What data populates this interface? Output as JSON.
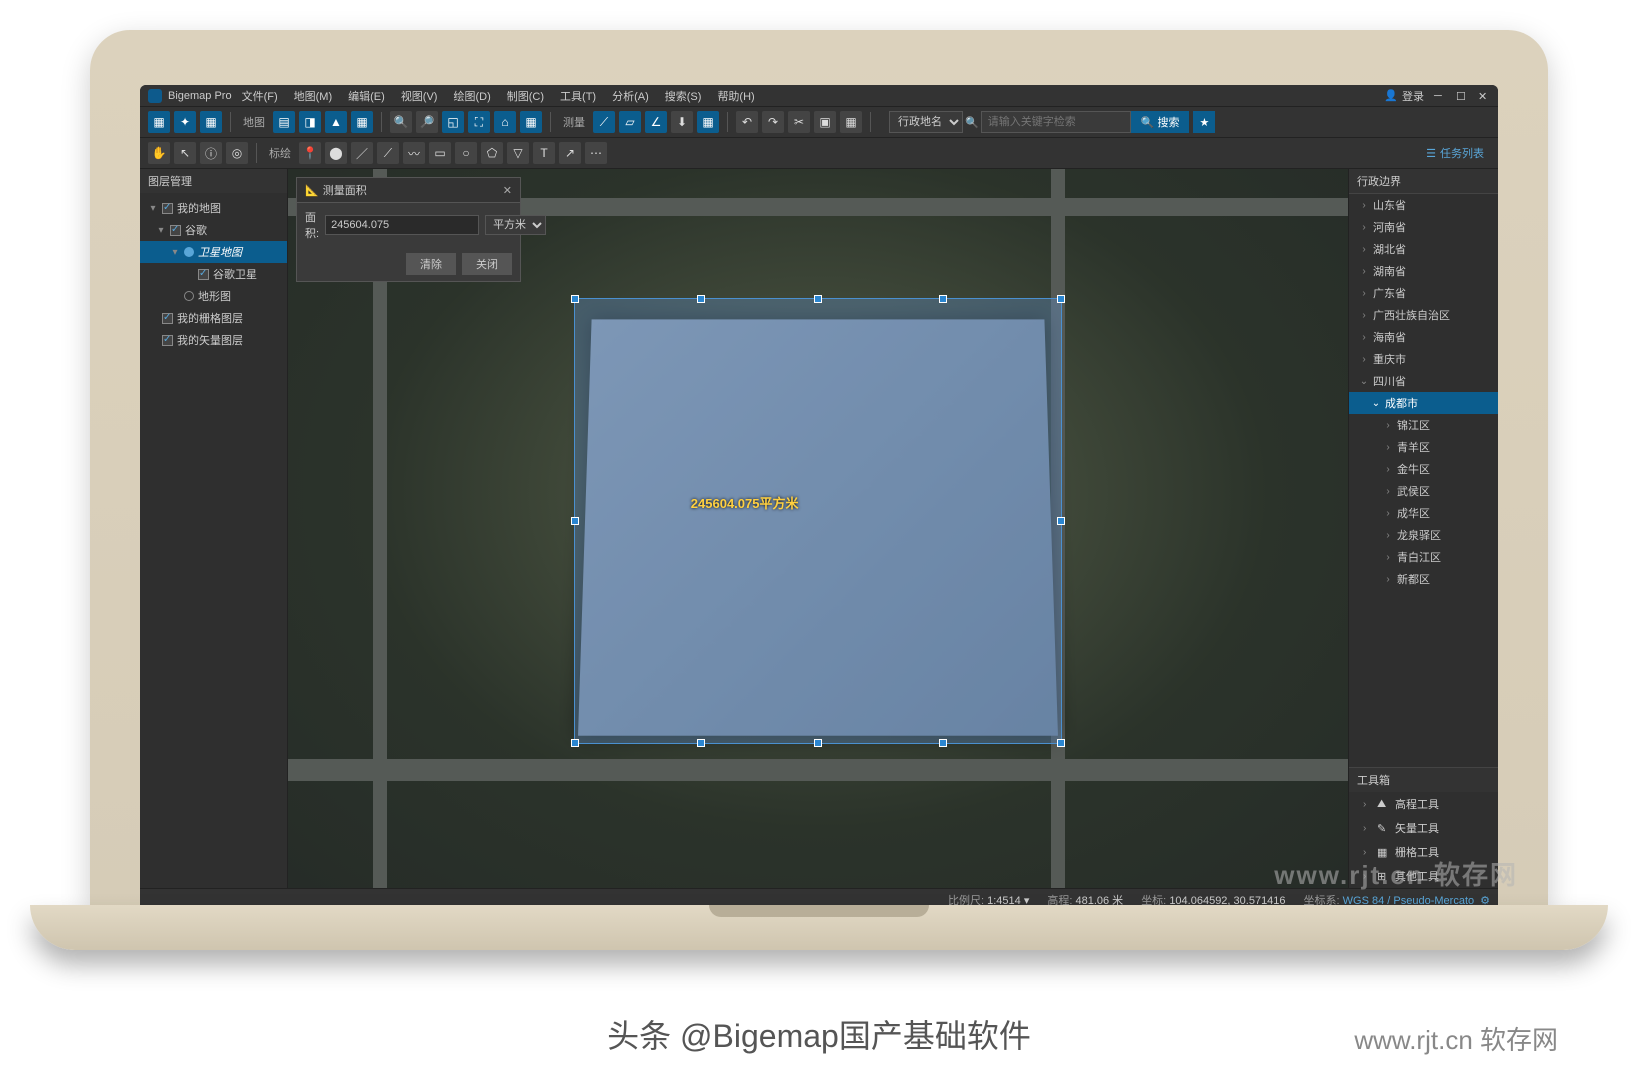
{
  "app": {
    "title": "Bigemap Pro",
    "login": "登录"
  },
  "menu": [
    "文件(F)",
    "地图(M)",
    "编辑(E)",
    "视图(V)",
    "绘图(D)",
    "制图(C)",
    "工具(T)",
    "分析(A)",
    "搜索(S)",
    "帮助(H)"
  ],
  "toolbar": {
    "group_map": "地图",
    "group_measure": "测量",
    "group_mark": "标绘",
    "search_type": "行政地名",
    "search_placeholder": "请输入关键字检索",
    "search_btn": "搜索",
    "tasklist": "任务列表"
  },
  "leftpanel": {
    "title": "图层管理",
    "my_map": "我的地图",
    "google": "谷歌",
    "satellite": "卫星地图",
    "google_sat": "谷歌卫星",
    "terrain": "地形图",
    "raster": "我的栅格图层",
    "vector": "我的矢量图层"
  },
  "measure": {
    "title": "测量面积",
    "area_label": "面积:",
    "area_value": "245604.075",
    "unit": "平方米",
    "clear": "清除",
    "close": "关闭",
    "overlay_text": "245604.075平方米"
  },
  "rightpanel": {
    "boundary_title": "行政边界",
    "provinces": [
      "山东省",
      "河南省",
      "湖北省",
      "湖南省",
      "广东省",
      "广西壮族自治区",
      "海南省",
      "重庆市"
    ],
    "sichuan": "四川省",
    "chengdu": "成都市",
    "districts": [
      "锦江区",
      "青羊区",
      "金牛区",
      "武侯区",
      "成华区",
      "龙泉驿区",
      "青白江区",
      "新都区"
    ],
    "toolbox_title": "工具箱",
    "tools": [
      "高程工具",
      "矢量工具",
      "栅格工具",
      "其他工具"
    ]
  },
  "status": {
    "scale_lbl": "比例尺:",
    "scale_val": "1:4514",
    "elev_lbl": "高程:",
    "elev_val": "481.06 米",
    "coord_lbl": "坐标:",
    "coord_val": "104.064592, 30.571416",
    "crs_lbl": "坐标系:",
    "crs_val": "WGS 84 / Pseudo-Mercato"
  },
  "watermark": "www.rjt.cn 软存网",
  "credit": "头条 @Bigemap国产基础软件",
  "credit2": "www.rjt.cn 软存网"
}
